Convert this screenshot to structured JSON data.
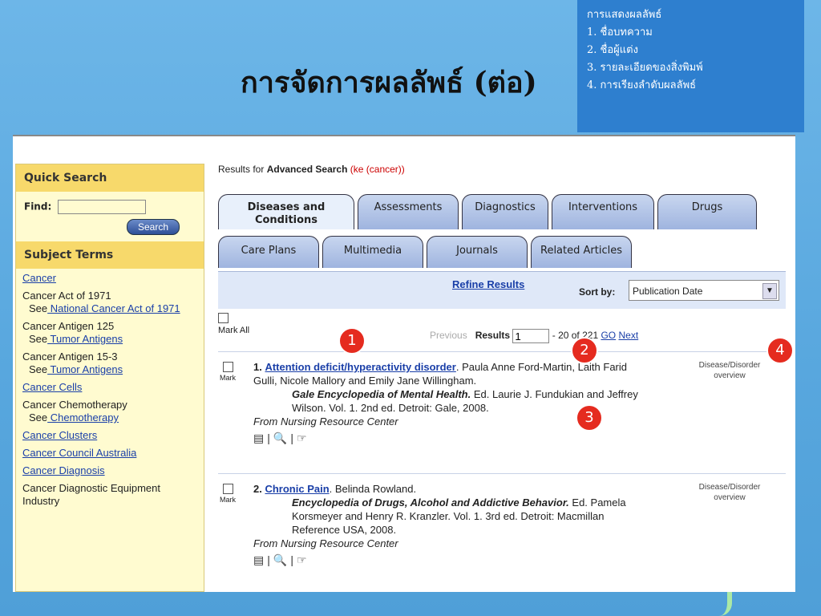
{
  "slide": {
    "title": "การจัดการผลลัพธ์ (ต่อ)",
    "info": [
      "การแสดงผลลัพธ์",
      "1. ชื่อบทความ",
      "2. ชื่อผู้แต่ง",
      "3. รายละเอียดของสิ่งพิมพ์",
      "4. การเรียงลำดับผลลัพธ์"
    ],
    "badges": [
      "1",
      "2",
      "3",
      "4"
    ]
  },
  "sidebar": {
    "quick_search": "Quick Search",
    "find_label": "Find:",
    "search_button": "Search",
    "subject_terms": "Subject Terms",
    "terms": [
      {
        "text": "Cancer",
        "link": true
      },
      {
        "text": "Cancer Act of 1971",
        "see": "See",
        "see_link": " National Cancer Act of 1971"
      },
      {
        "text": "Cancer Antigen 125",
        "see": "See",
        "see_link": " Tumor Antigens"
      },
      {
        "text": "Cancer Antigen 15-3",
        "see": "See",
        "see_link": " Tumor Antigens"
      },
      {
        "text": "Cancer Cells",
        "link": true
      },
      {
        "text": "Cancer Chemotherapy",
        "see": "See",
        "see_link": " Chemotherapy"
      },
      {
        "text": "Cancer Clusters",
        "link": true
      },
      {
        "text": "Cancer Council Australia",
        "link": true
      },
      {
        "text": "Cancer Diagnosis",
        "link": true
      },
      {
        "text": "Cancer Diagnostic Equipment Industry"
      }
    ]
  },
  "main": {
    "results_for": "Results for",
    "adv_search": "Advanced Search",
    "query": "(ke (cancer))",
    "tabs_row1": [
      "Diseases and Conditions",
      "Assessments",
      "Diagnostics",
      "Interventions",
      "Drugs"
    ],
    "tabs_row2": [
      "Care Plans",
      "Multimedia",
      "Journals",
      "Related Articles"
    ],
    "refine": "Refine Results",
    "sort_by": "Sort by:",
    "sort_value": "Publication Date",
    "mark_all": "Mark All",
    "previous": "Previous",
    "results_label": "Results",
    "results_start": "1",
    "results_range": "- 20 of 221",
    "go": "GO",
    "next": "Next",
    "mark": "Mark",
    "results": [
      {
        "num": "1.",
        "title": "Attention deficit/hyperactivity disorder",
        "authors": ". Paula Anne Ford-Martin, Laith Farid Gulli, Nicole Mallory and Emily Jane Willingham.",
        "source": "Gale Encyclopedia of Mental Health.",
        "details": " Ed. Laurie J. Fundukian and Jeffrey Wilson. Vol. 1. 2nd ed. Detroit: Gale, 2008.",
        "from": "From Nursing Resource Center",
        "side": "Disease/Disorder overview"
      },
      {
        "num": "2.",
        "title": "Chronic Pain",
        "authors": ". Belinda Rowland.",
        "source": "Encyclopedia of Drugs, Alcohol and Addictive Behavior.",
        "details": " Ed. Pamela Korsmeyer and Henry R. Kranzler. Vol. 1. 3rd ed. Detroit: Macmillan Reference USA, 2008.",
        "from": "From Nursing Resource Center",
        "side": "Disease/Disorder overview"
      }
    ]
  }
}
